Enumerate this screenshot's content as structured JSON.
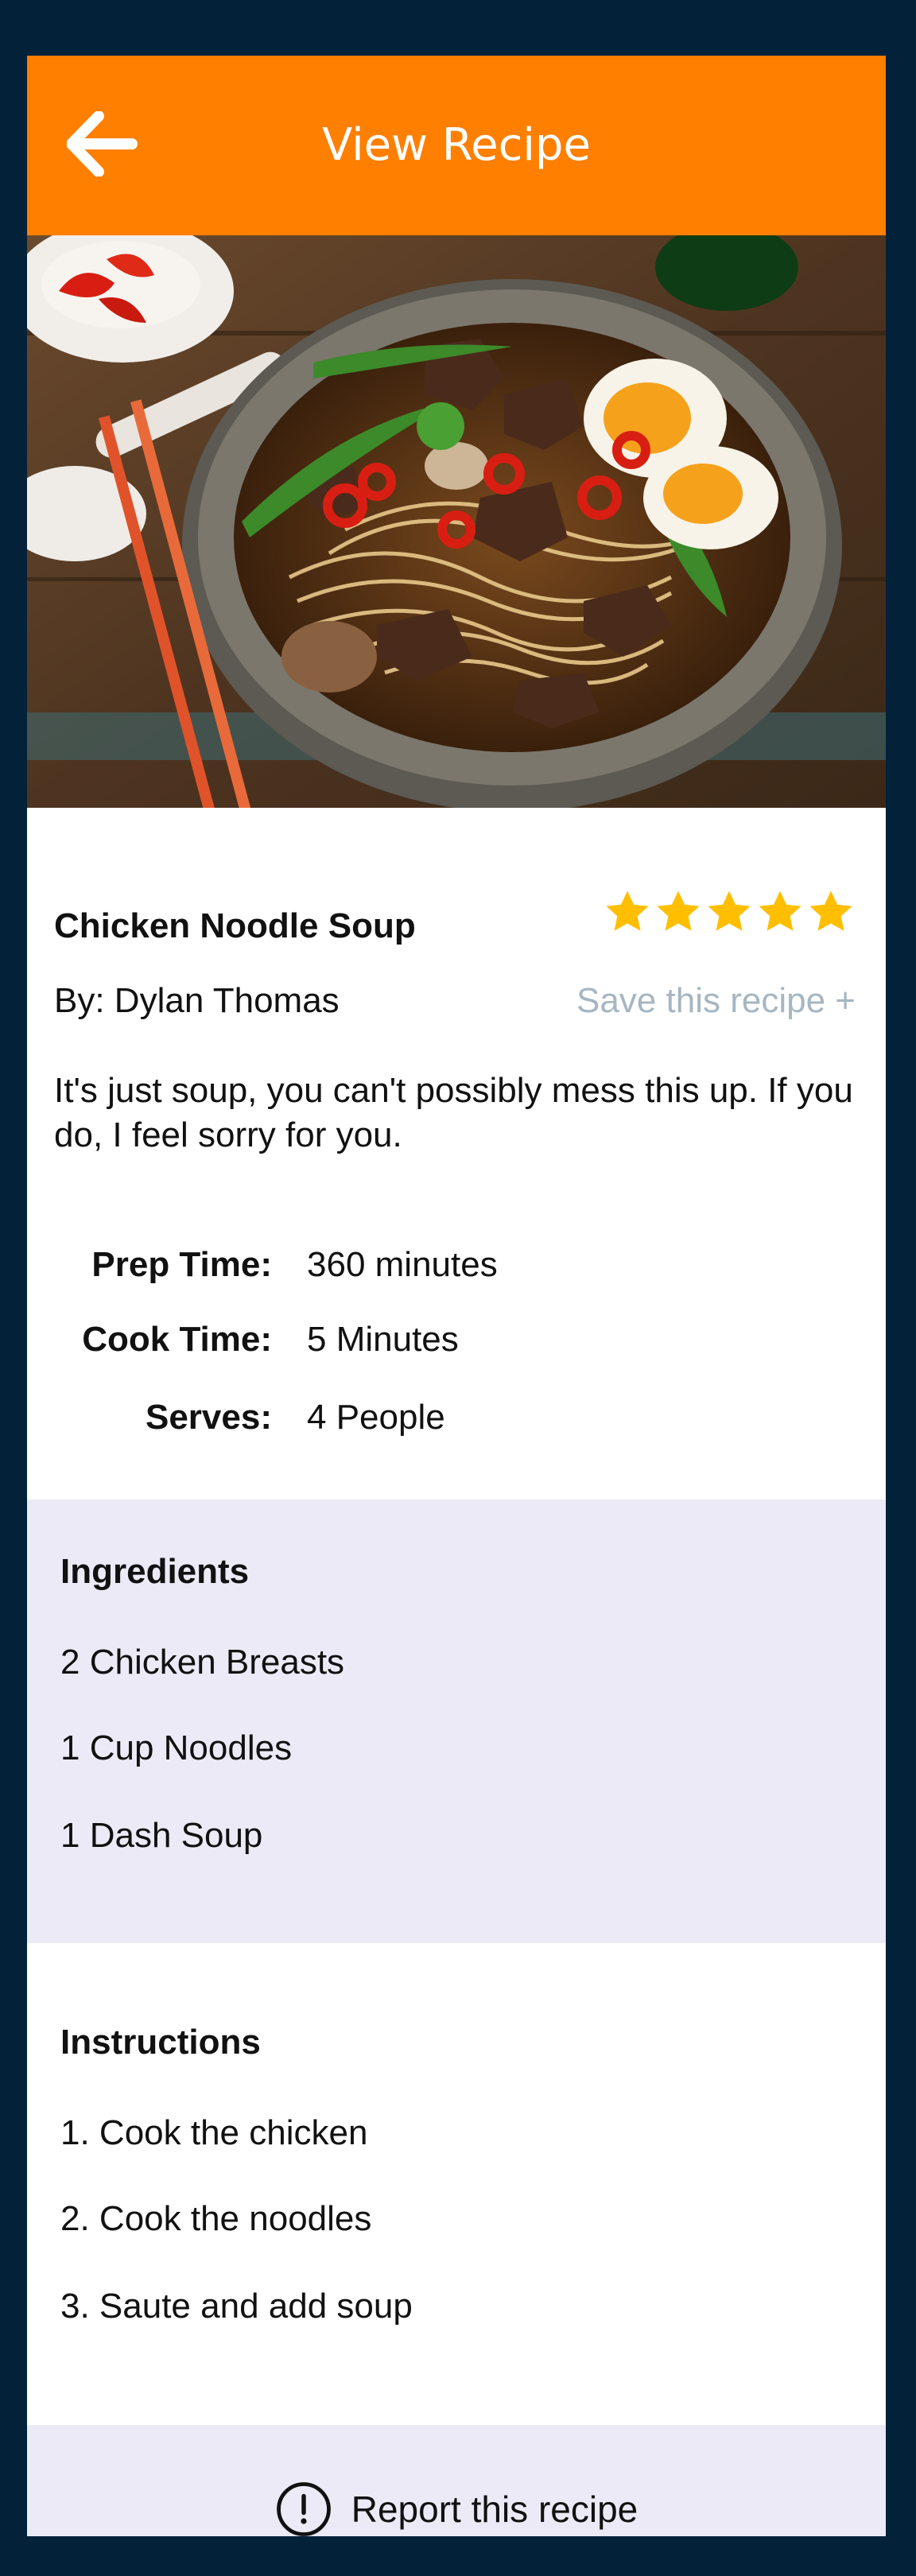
{
  "header": {
    "title": "View Recipe",
    "back_icon": "arrow-left-icon",
    "color": "#ff7f00"
  },
  "hero": {
    "icon": "noodle-soup-photo"
  },
  "recipe": {
    "title": "Chicken Noodle Soup",
    "rating": 5,
    "rating_max": 5,
    "star_color": "#ffbf00",
    "author": "By: Dylan Thomas",
    "save_label": "Save this recipe +",
    "description": "It's just soup, you can't possibly mess this up. If you do, I feel sorry for you.",
    "meta": [
      {
        "label": "Prep Time:",
        "value": "360 minutes"
      },
      {
        "label": "Cook Time:",
        "value": "5 Minutes"
      },
      {
        "label": "Serves:",
        "value": "4 People"
      }
    ]
  },
  "ingredients": {
    "title": "Ingredients",
    "items": [
      "2 Chicken Breasts",
      "1 Cup Noodles",
      "1 Dash Soup"
    ]
  },
  "instructions": {
    "title": "Instructions",
    "items": [
      "1. Cook the chicken",
      "2. Cook the noodles",
      "3. Saute and add soup"
    ]
  },
  "report": {
    "label": "Report this recipe",
    "icon": "alert-circle-icon"
  },
  "colors": {
    "background": "#04213a",
    "section_bg": "#edeaf7",
    "muted_text": "#a6b6c2"
  }
}
